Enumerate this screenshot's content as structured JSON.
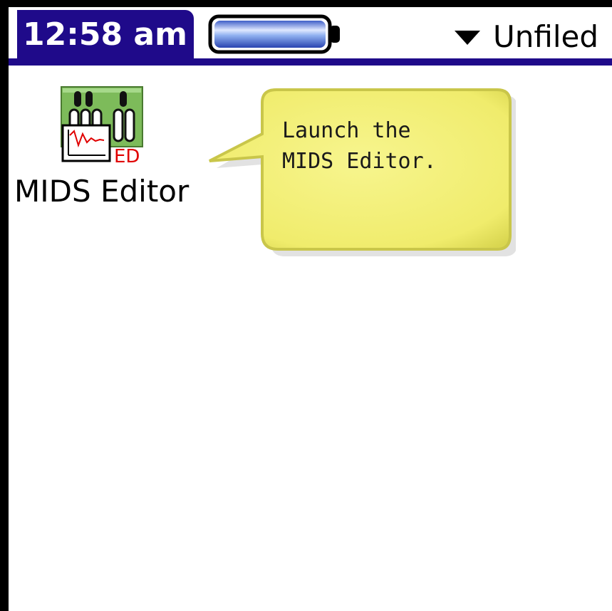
{
  "status_bar": {
    "time": "12:58 am",
    "battery_level": 1.0,
    "category": "Unfiled"
  },
  "launcher": {
    "apps": [
      {
        "label": "MIDS Editor",
        "badge": "ED"
      }
    ]
  },
  "callout": {
    "line1": "Launch the",
    "line2": "MIDS Editor."
  },
  "colors": {
    "title_bar": "#1f0a8a",
    "callout_fill": "#f3f07a",
    "callout_border": "#c9c64a",
    "battery_fill": "#7fa6e8",
    "badge_text": "#e00000",
    "icon_board": "#7dbb5a"
  }
}
